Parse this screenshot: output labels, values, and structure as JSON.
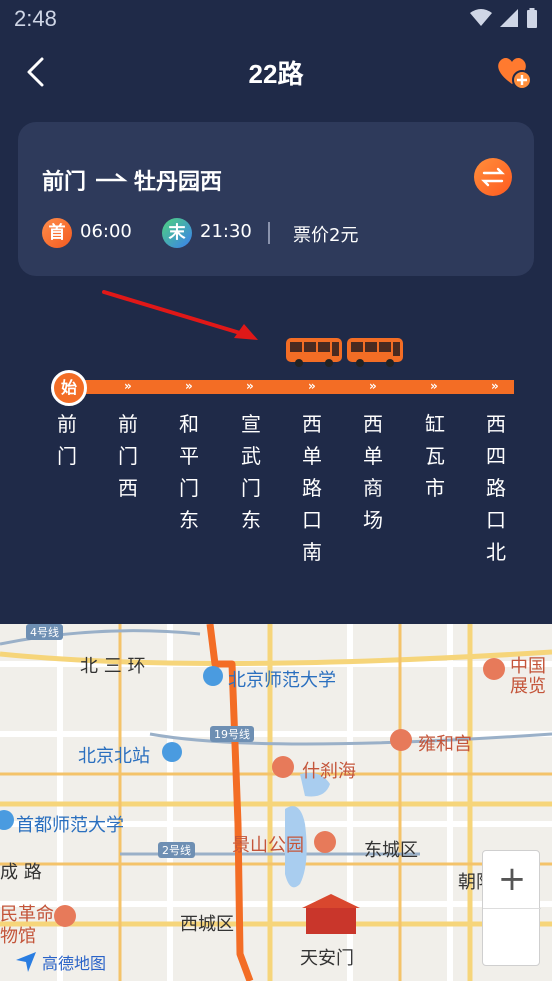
{
  "status_bar": {
    "time": "2:48"
  },
  "header": {
    "title": "22路"
  },
  "card": {
    "from": "前门",
    "to": "牡丹园西",
    "first_badge": "首",
    "first_time": "06:00",
    "last_badge": "末",
    "last_time": "21:30",
    "fare": "票价2元"
  },
  "line": {
    "start_badge": "始",
    "stations": [
      "前门",
      "前门西",
      "和平门东",
      "宣武门东",
      "西单路口南",
      "西单商场",
      "缸瓦市",
      "西四路口北"
    ]
  },
  "map": {
    "labels": {
      "beisanhuan": "北 三 环",
      "bnu": "北京师范大学",
      "beijingbei": "北京北站",
      "shichahai": "什刹海",
      "yonghegong": "雍和宫",
      "cnu": "首都师范大学",
      "jingshan": "景山公园",
      "dongcheng": "东城区",
      "xicheng": "西城区",
      "tiananmen": "天安门",
      "chengcheng": "成 路",
      "chaoyang": "朝阳",
      "revolution": "民革命",
      "museum": "物馆",
      "exhibit1": "中国",
      "exhibit2": "展览",
      "road_4": "4号线",
      "road_19": "19号线",
      "road_2": "2号线"
    },
    "logo": "高德地图",
    "zoom_in": "+"
  },
  "colors": {
    "background": "#1f2a48",
    "card": "#2e3a5b",
    "accent": "#f36d25"
  }
}
